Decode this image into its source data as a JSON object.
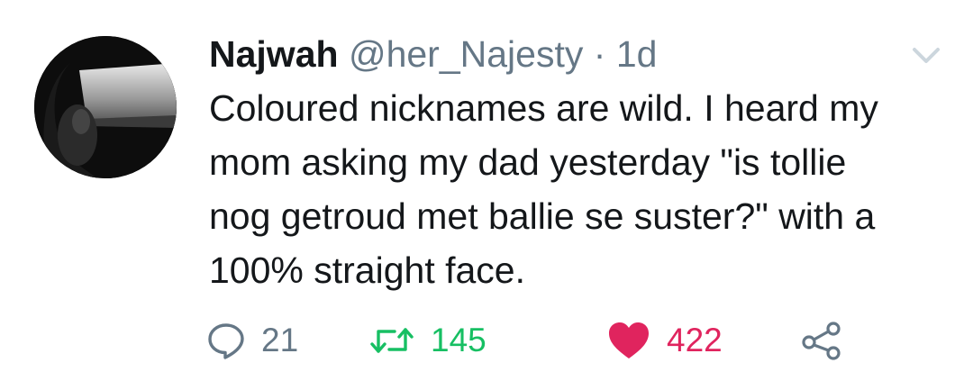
{
  "tweet": {
    "author_name": "Najwah",
    "author_handle": "@her_Najesty",
    "separator": "·",
    "timestamp": "1d",
    "text": "Coloured nicknames are wild. I heard my\nmom asking my dad yesterday \"is tollie\nnog getroud met ballie se suster?\" with a\n100% straight face.",
    "avatar_icon": "profile-photo"
  },
  "actions": {
    "reply": {
      "icon": "reply-icon",
      "count": "21",
      "color": "#657786"
    },
    "retweet": {
      "icon": "retweet-icon",
      "count": "145",
      "color": "#17bf63"
    },
    "like": {
      "icon": "heart-icon",
      "count": "422",
      "color": "#e0245e"
    },
    "share": {
      "icon": "share-icon",
      "color": "#657786"
    }
  },
  "menu": {
    "icon": "chevron-down-icon",
    "color": "#ccd6dd"
  }
}
